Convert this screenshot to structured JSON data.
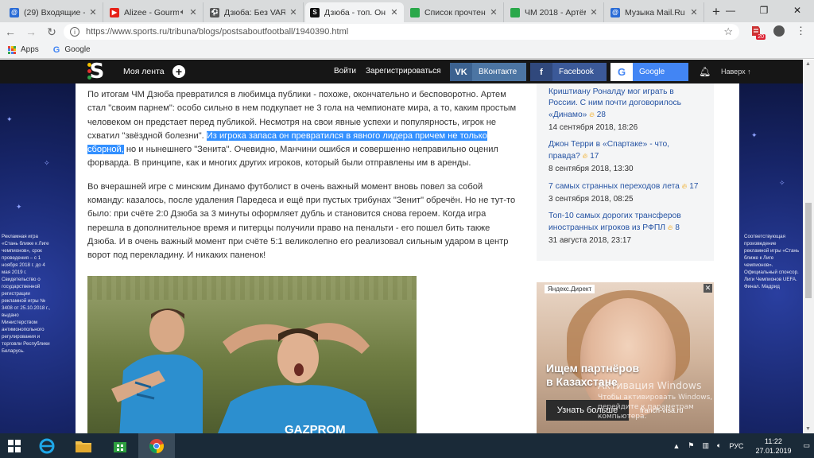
{
  "browser": {
    "tabs": [
      {
        "title": "(29) Входящие - П",
        "favicon": "mail-at-icon",
        "color": "#2a6cd6",
        "glyph": "@"
      },
      {
        "title": "Alizee - Gourm",
        "favicon": "youtube-icon",
        "color": "#e62117",
        "glyph": "▶",
        "muted": true
      },
      {
        "title": "Дзюба: Без VAR м",
        "favicon": "football-icon",
        "color": "#555555",
        "glyph": "⚽"
      },
      {
        "title": "Дзюба - топ. Он б",
        "favicon": "sports-s-icon",
        "color": "#111111",
        "glyph": "S",
        "active": true
      },
      {
        "title": "Список прочтений",
        "favicon": "sheet-icon",
        "color": "#2aa84a",
        "glyph": ""
      },
      {
        "title": "ЧМ 2018 - Артём Д",
        "favicon": "sheet-icon",
        "color": "#2aa84a",
        "glyph": ""
      },
      {
        "title": "Музыка Mail.Ru - з",
        "favicon": "mail-at-icon",
        "color": "#2a6cd6",
        "glyph": "@"
      }
    ],
    "new_tab": "+",
    "url": "https://www.sports.ru/tribuna/blogs/postsaboutfootball/1940390.html",
    "ext_badge": "20",
    "bookmarks": [
      {
        "label": "Apps",
        "icon": "apps-grid-icon"
      },
      {
        "label": "Google",
        "icon": "google-icon"
      }
    ]
  },
  "site": {
    "feed": "Моя лента",
    "login": "Войти",
    "register": "Зарегистрироваться",
    "social": {
      "vk": "ВКонтакте",
      "fb": "Facebook",
      "google": "Google"
    },
    "up": "Наверх ↑",
    "colors": {
      "header": "#161616",
      "vk": "#4c75a3",
      "fb": "#3b5998",
      "google": "#4285f4",
      "link": "#2553a3",
      "selection": "#3390ff"
    }
  },
  "article": {
    "p1_a": "По итогам ЧМ Дзюба превратился в любимца публики - похоже, окончательно и бесповоротно. Артем стал \"своим парнем\": особо сильно в нем подкупает не 3 гола на чемпионате мира, а то, каким простым человеком он предстает перед публикой. Несмотря на свои явные успехи и популярность, игрок не схватил \"звёздной болезни\". ",
    "p1_hl": "Из игрока запаса он превратился в явного лидера причем не только сборной,",
    "p1_b": " но и нынешнего \"Зенита\". Очевидно, Манчини ошибся и совершенно неправильно оценил форварда. В принципе, как и многих других игроков, который были отправлены им в аренды.",
    "p2": "Во вчерашней игре с минским Динамо футболист в очень важный момент вновь повел за собой команду: казалось, после удаления Паредеса и ещё при пустых трибунах \"Зенит\" обречён. Но не тут-то было: при счёте 2:0 Дзюба за 3 минуты оформляет дубль и становится снова героем. Когда игра перешла в дополнительное время и питерцы получили право на пенальти - его пошел бить также Дзюба. И в очень важный момент при счёте 5:1 великолепно его реализовал сильным ударом в центр ворот под перекладину. И никаких паненок!",
    "jersey_text": "GAZPROM"
  },
  "news": [
    {
      "title": "Криштиану Роналду мог играть в России. С ним почти договорилось «Динамо»",
      "count": "28",
      "date": "14 сентября 2018, 18:26"
    },
    {
      "title": "Джон Терри в «Спартаке» - что, правда?",
      "count": "17",
      "date": "8 сентября 2018, 13:30"
    },
    {
      "title": "7 самых странных переходов лета",
      "count": "17",
      "date": "3 сентября 2018, 08:25"
    },
    {
      "title": "Топ-10 самых дорогих трансферов иностранных игроков из РФПЛ",
      "count": "8",
      "date": "31 августа 2018, 23:17"
    }
  ],
  "ad": {
    "label": "Яндекс.Директ",
    "headline_1": "Ищем партнёров",
    "headline_2": "в Казахстане",
    "cta": "Узнать больше",
    "domain": "franch-visa.ru"
  },
  "side": {
    "left_legal": "Рекламная игра «Стань ближе к Лиге чемпионов», срок проведения – с 1 ноября 2018 г. до 4 мая 2019 г. Свидетельство о государственной регистрации рекламной игры № 3408 от 25.10.2018 г., выдано Министерством антимонопольного регулирования и торговли Республики Беларусь.",
    "right_legal": "Соответствующая произведение рекламной игры «Стань ближе к Лиге чемпионов». Официальный спонсор. Лиги Чемпионов UEFA. Финал. Мадрид"
  },
  "watermark": {
    "line1": "Активация Windows",
    "line2": "Чтобы активировать Windows, перейдите к параметрам компьютера."
  },
  "taskbar": {
    "lang": "РУС",
    "time": "11:22",
    "date": "27.01.2019"
  }
}
